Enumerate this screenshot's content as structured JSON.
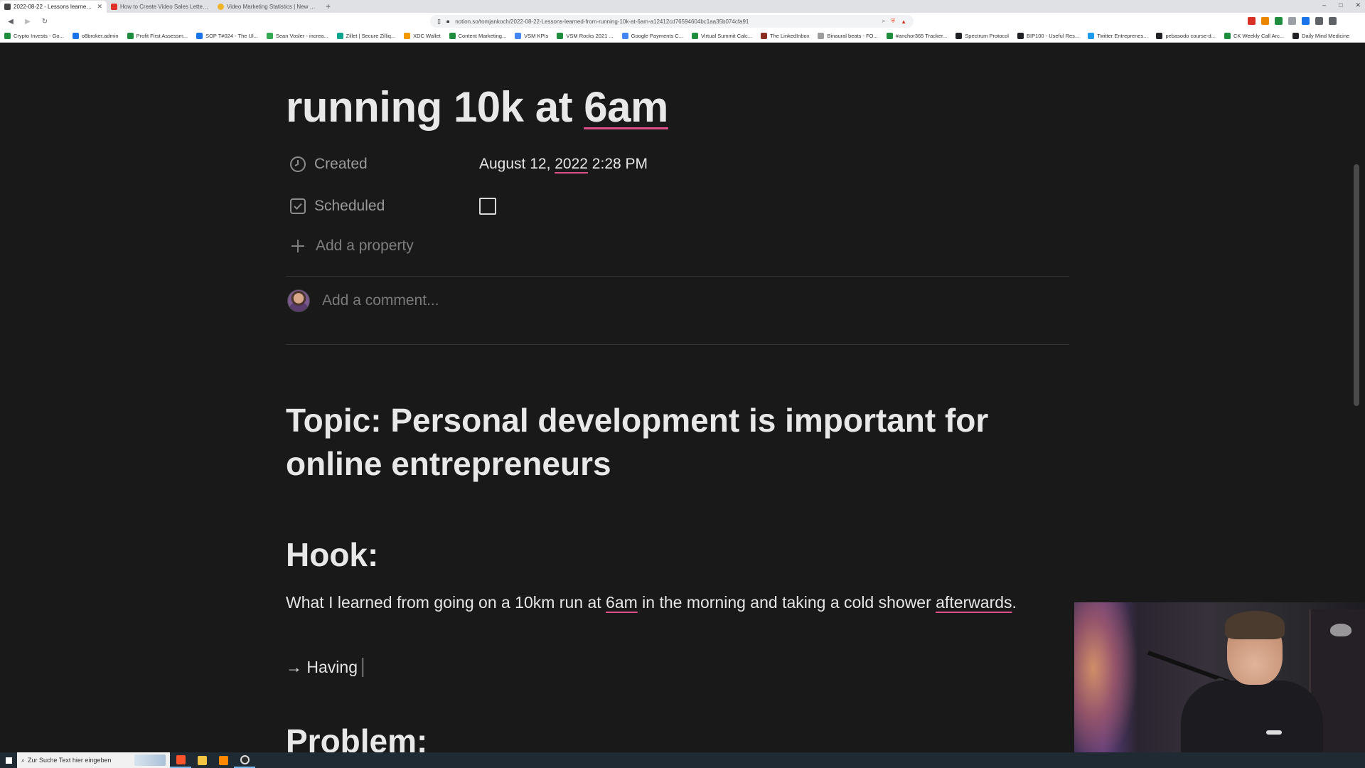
{
  "browser": {
    "tabs": [
      {
        "title": "2022-08-22 - Lessons learned fro",
        "active": true,
        "color": "#444444"
      },
      {
        "title": "How to Create Video Sales Letters Th",
        "active": false,
        "color": "#e0312b"
      },
      {
        "title": "Video Marketing Statistics | New Data",
        "active": false,
        "color": "#f0b429"
      }
    ],
    "new_tab_symbol": "+",
    "window_controls": [
      "–",
      "□",
      "✕"
    ],
    "url": "notion.so/tomjankoch/2022-08-22-Lessons-learned-from-running-10k-at-6am-a12412cd76594604bc1aa35b074cfa91",
    "bookmarks": [
      {
        "label": "Crypto Invests - Go...",
        "color": "#1e8e3e"
      },
      {
        "label": "o8broker.admin",
        "color": "#1a73e8"
      },
      {
        "label": "Profit First Assessm...",
        "color": "#1e8e3e"
      },
      {
        "label": "SOP T#024 - The Ul...",
        "color": "#1a73e8"
      },
      {
        "label": "Sean Vosler - increa...",
        "color": "#34a853"
      },
      {
        "label": "Zillet | Secure Zilliq...",
        "color": "#0aa58f"
      },
      {
        "label": "XDC Wallet",
        "color": "#f29900"
      },
      {
        "label": "Content Marketing...",
        "color": "#1e8e3e"
      },
      {
        "label": "VSM KPIs",
        "color": "#4285f4"
      },
      {
        "label": "VSM Rocks 2021 ...",
        "color": "#1e8e3e"
      },
      {
        "label": "Google Payments C...",
        "color": "#4285f4"
      },
      {
        "label": "Virtual Summit Calc...",
        "color": "#1e8e3e"
      },
      {
        "label": "The LinkedInbox",
        "color": "#8b2d20"
      },
      {
        "label": "Binaural beats - FO...",
        "color": "#9e9e9e"
      },
      {
        "label": "#anchor365 Tracker...",
        "color": "#1e8e3e"
      },
      {
        "label": "Spectrum Protocol",
        "color": "#202124"
      },
      {
        "label": "BIP100 - Useful Res...",
        "color": "#202124"
      },
      {
        "label": "Twitter Entreprenes...",
        "color": "#1d9bf0"
      },
      {
        "label": "pebasodo course-d...",
        "color": "#202124"
      },
      {
        "label": "CK Weekly Call Arc...",
        "color": "#1e8e3e"
      },
      {
        "label": "Daily Mind Medicine",
        "color": "#202124"
      }
    ],
    "extension_colors": [
      "#d93025",
      "#ea8600",
      "#1e8e3e",
      "#9aa0a6",
      "#1a73e8",
      "#5f6368",
      "#5f6368"
    ]
  },
  "notion": {
    "title_prefix": "running 10k at ",
    "title_highlight": "6am",
    "properties": [
      {
        "icon": "clock-icon",
        "label": "Created",
        "value_prefix": "August 12, ",
        "value_highlight": "2022",
        "value_suffix": " 2:28 PM"
      },
      {
        "icon": "checkbox-icon",
        "label": "Scheduled",
        "checked": false
      }
    ],
    "add_property_label": "Add a property",
    "comment_placeholder": "Add a comment...",
    "topic_heading": "Topic: Personal development is important for online entrepreneurs",
    "hook_heading": "Hook:",
    "hook_text_part1": "What I learned from going on a 10km run at ",
    "hook_text_highlight1": "6am",
    "hook_text_part2": " in the morning and taking a cold shower ",
    "hook_text_highlight2": "afterwards",
    "hook_text_part3": ".",
    "having_line": "→ Having",
    "problem_heading": "Problem:",
    "spellcheck_color": "#e0508a"
  },
  "taskbar": {
    "search_placeholder": "Zur Suche Text hier eingeben",
    "apps": [
      {
        "name": "brave-browser",
        "color": "#fb542b",
        "active": true
      },
      {
        "name": "file-explorer",
        "color": "#f4c542",
        "active": false
      },
      {
        "name": "vlc-player",
        "color": "#ff8800",
        "active": false
      },
      {
        "name": "obs-studio",
        "color": "#2d2d2d",
        "active": true
      }
    ]
  }
}
